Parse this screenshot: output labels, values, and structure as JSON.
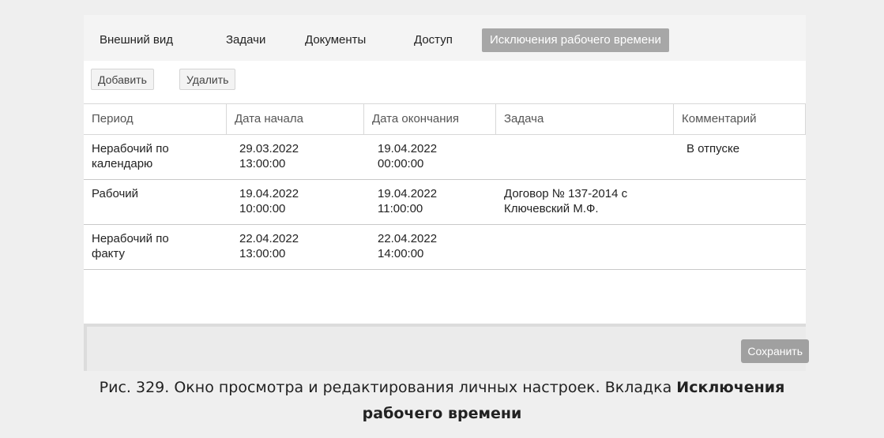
{
  "tabs": [
    {
      "label": "Внешний вид"
    },
    {
      "label": "Задачи"
    },
    {
      "label": "Документы"
    },
    {
      "label": "Доступ"
    },
    {
      "label": "Исключения рабочего времени",
      "active": true
    }
  ],
  "toolbar": {
    "add_label": "Добавить",
    "delete_label": "Удалить"
  },
  "table": {
    "columns": [
      "Период",
      "Дата начала",
      "Дата окончания",
      "Задача",
      "Комментарий"
    ],
    "rows": [
      {
        "period": [
          "Нерабочий по",
          "календарю"
        ],
        "start": [
          "29.03.2022",
          "13:00:00"
        ],
        "end": [
          "19.04.2022",
          "00:00:00"
        ],
        "task": [
          "",
          ""
        ],
        "comment": "В отпуске"
      },
      {
        "period": [
          "Рабочий",
          ""
        ],
        "start": [
          "19.04.2022",
          "10:00:00"
        ],
        "end": [
          "19.04.2022",
          "11:00:00"
        ],
        "task": [
          "Договор № 137-2014 с",
          "Ключевский М.Ф."
        ],
        "comment": ""
      },
      {
        "period": [
          "Нерабочий по",
          "факту"
        ],
        "start": [
          "22.04.2022",
          "13:00:00"
        ],
        "end": [
          "22.04.2022",
          "14:00:00"
        ],
        "task": [
          "",
          ""
        ],
        "comment": ""
      }
    ]
  },
  "footer": {
    "save_label": "Сохранить"
  },
  "caption": {
    "prefix": "Рис. 329. Окно просмотра и редактирования личных настроек. Вкладка ",
    "bold_1": "Исключения",
    "bold_2": "рабочего времени"
  }
}
